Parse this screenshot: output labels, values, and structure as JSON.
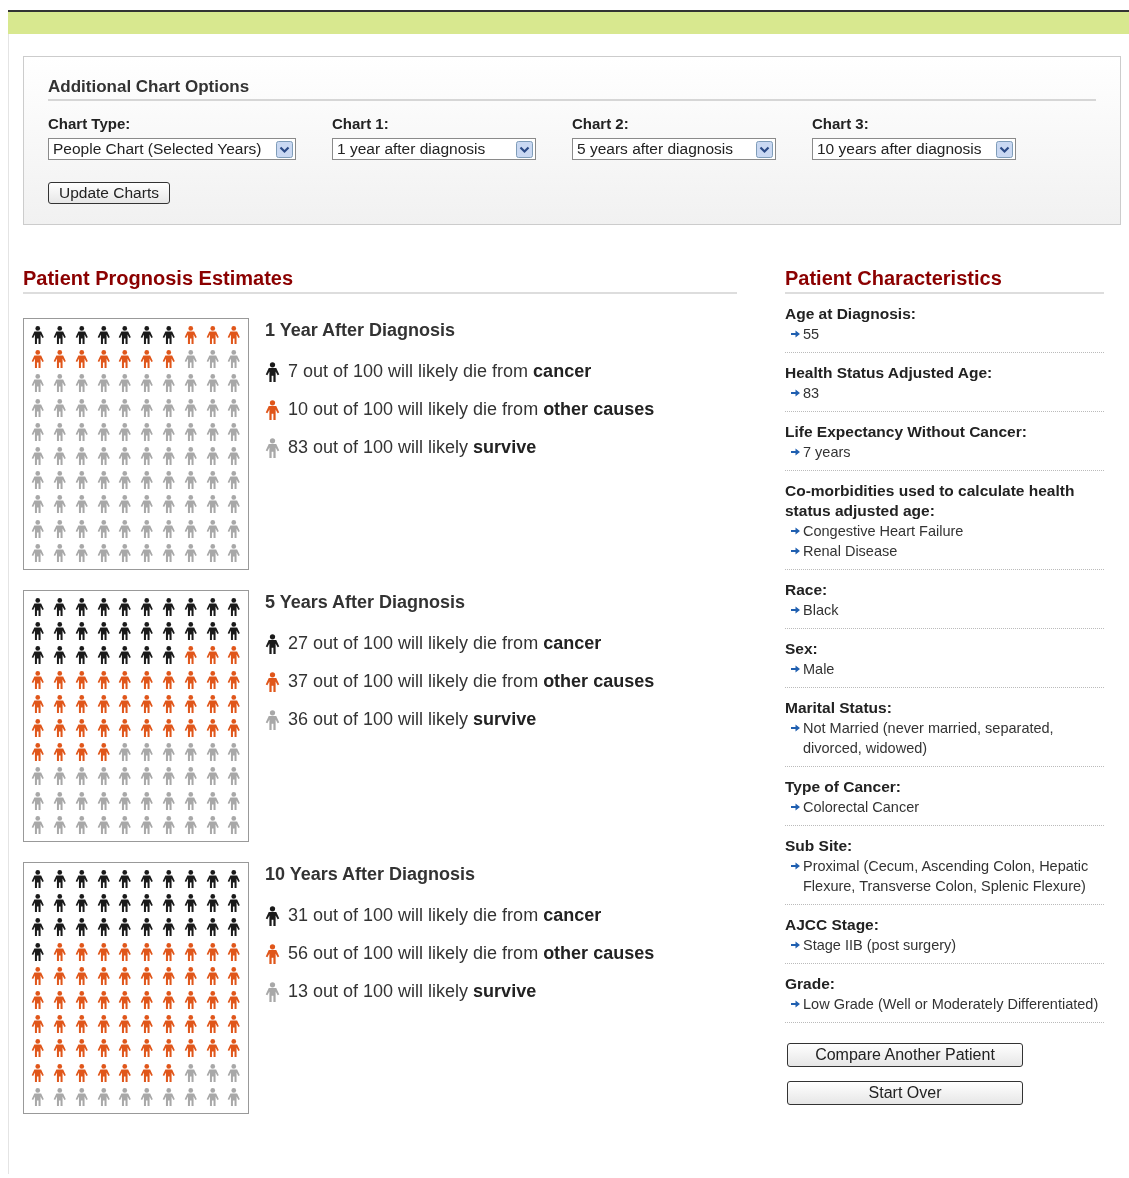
{
  "options": {
    "title": "Additional Chart Options",
    "fields": [
      {
        "label": "Chart Type:",
        "value": "People Chart (Selected Years)"
      },
      {
        "label": "Chart 1:",
        "value": "1 year after diagnosis"
      },
      {
        "label": "Chart 2:",
        "value": "5 years after diagnosis"
      },
      {
        "label": "Chart 3:",
        "value": "10 years after diagnosis"
      }
    ],
    "button": "Update Charts"
  },
  "prognosis": {
    "title": "Patient Prognosis Estimates",
    "charts": [
      {
        "title": "1 Year After Diagnosis",
        "legend": [
          {
            "color": "#1a1a1a",
            "text": "7 out of 100 will likely die from **cancer**"
          },
          {
            "color": "#e0561a",
            "text": "10 out of 100 will likely die from **other causes**"
          },
          {
            "color": "#a8a8a8",
            "text": "83 out of 100 will likely **survive**"
          }
        ]
      },
      {
        "title": "5 Years After Diagnosis",
        "legend": [
          {
            "color": "#1a1a1a",
            "text": "27 out of 100 will likely die from **cancer**"
          },
          {
            "color": "#e0561a",
            "text": "37 out of 100 will likely die from **other causes**"
          },
          {
            "color": "#a8a8a8",
            "text": "36 out of 100 will likely **survive**"
          }
        ]
      },
      {
        "title": "10 Years After Diagnosis",
        "legend": [
          {
            "color": "#1a1a1a",
            "text": "31 out of 100 will likely die from **cancer**"
          },
          {
            "color": "#e0561a",
            "text": "56 out of 100 will likely die from **other causes**"
          },
          {
            "color": "#a8a8a8",
            "text": "13 out of 100 will likely **survive**"
          }
        ]
      }
    ]
  },
  "characteristics": {
    "title": "Patient Characteristics",
    "items": [
      {
        "label": "Age at Diagnosis:",
        "values": [
          "55"
        ]
      },
      {
        "label": "Health Status Adjusted Age:",
        "values": [
          "83"
        ]
      },
      {
        "label": "Life Expectancy Without Cancer:",
        "values": [
          "7 years"
        ]
      },
      {
        "label": "Co-morbidities used to calculate health status adjusted age:",
        "values": [
          "Congestive Heart Failure",
          "Renal Disease"
        ]
      },
      {
        "label": "Race:",
        "values": [
          "Black"
        ]
      },
      {
        "label": "Sex:",
        "values": [
          "Male"
        ]
      },
      {
        "label": "Marital Status:",
        "values": [
          "Not Married (never married, separated, divorced, widowed)"
        ]
      },
      {
        "label": "Type of Cancer:",
        "values": [
          "Colorectal Cancer"
        ]
      },
      {
        "label": "Sub Site:",
        "values": [
          "Proximal (Cecum, Ascending Colon, Hepatic Flexure, Transverse Colon, Splenic Flexure)"
        ]
      },
      {
        "label": "AJCC Stage:",
        "values": [
          "Stage IIB (post surgery)"
        ]
      },
      {
        "label": "Grade:",
        "values": [
          "Low Grade (Well or Moderately Differentiated)"
        ]
      }
    ],
    "buttons": [
      "Compare Another Patient",
      "Start Over"
    ]
  }
}
